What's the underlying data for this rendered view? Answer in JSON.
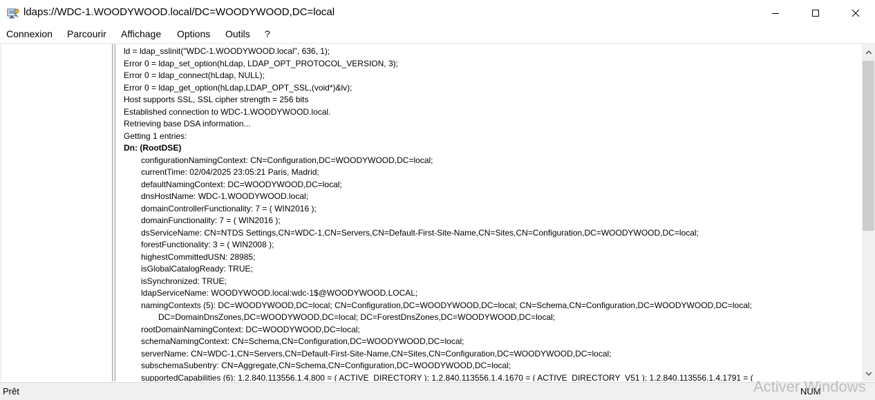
{
  "window": {
    "title": "ldaps://WDC-1.WOODYWOOD.local/DC=WOODYWOOD,DC=local"
  },
  "icons": {
    "app": "ldp-app-icon",
    "minimize": "minimize-icon",
    "maximize": "maximize-icon",
    "close": "close-icon",
    "scroll_up": "chevron-up-icon",
    "scroll_down": "chevron-down-icon"
  },
  "menu": {
    "items": [
      "Connexion",
      "Parcourir",
      "Affichage",
      "Options",
      "Outils",
      "?"
    ]
  },
  "log": {
    "lines": [
      {
        "text": "ld = ldap_sslinit(\"WDC-1.WOODYWOOD.local\", 636, 1);",
        "style": "normal"
      },
      {
        "text": "Error 0 = ldap_set_option(hLdap, LDAP_OPT_PROTOCOL_VERSION, 3);",
        "style": "normal"
      },
      {
        "text": "Error 0 = ldap_connect(hLdap, NULL);",
        "style": "normal"
      },
      {
        "text": "Error 0 = ldap_get_option(hLdap,LDAP_OPT_SSL,(void*)&lv);",
        "style": "normal"
      },
      {
        "text": "Host supports SSL, SSL cipher strength = 256 bits",
        "style": "normal"
      },
      {
        "text": "Established connection to WDC-1.WOODYWOOD.local.",
        "style": "normal"
      },
      {
        "text": "Retrieving base DSA information...",
        "style": "normal"
      },
      {
        "text": "Getting 1 entries:",
        "style": "normal"
      },
      {
        "text": "Dn: (RootDSE)",
        "style": "bold"
      },
      {
        "text": "configurationNamingContext: CN=Configuration,DC=WOODYWOOD,DC=local;",
        "style": "indent1"
      },
      {
        "text": "currentTime: 02/04/2025 23:05:21 Paris, Madrid;",
        "style": "indent1"
      },
      {
        "text": "defaultNamingContext: DC=WOODYWOOD,DC=local;",
        "style": "indent1"
      },
      {
        "text": "dnsHostName: WDC-1.WOODYWOOD.local;",
        "style": "indent1"
      },
      {
        "text": "domainControllerFunctionality: 7 = ( WIN2016 );",
        "style": "indent1"
      },
      {
        "text": "domainFunctionality: 7 = ( WIN2016 );",
        "style": "indent1"
      },
      {
        "text": "dsServiceName: CN=NTDS Settings,CN=WDC-1,CN=Servers,CN=Default-First-Site-Name,CN=Sites,CN=Configuration,DC=WOODYWOOD,DC=local;",
        "style": "indent1"
      },
      {
        "text": "forestFunctionality: 3 = ( WIN2008 );",
        "style": "indent1"
      },
      {
        "text": "highestCommittedUSN: 28985;",
        "style": "indent1"
      },
      {
        "text": "isGlobalCatalogReady: TRUE;",
        "style": "indent1"
      },
      {
        "text": "isSynchronized: TRUE;",
        "style": "indent1"
      },
      {
        "text": "ldapServiceName: WOODYWOOD.local:wdc-1$@WOODYWOOD.LOCAL;",
        "style": "indent1"
      },
      {
        "text": "namingContexts (5): DC=WOODYWOOD,DC=local; CN=Configuration,DC=WOODYWOOD,DC=local; CN=Schema,CN=Configuration,DC=WOODYWOOD,DC=local;",
        "style": "indent1"
      },
      {
        "text": "DC=DomainDnsZones,DC=WOODYWOOD,DC=local; DC=ForestDnsZones,DC=WOODYWOOD,DC=local;",
        "style": "indent2"
      },
      {
        "text": "rootDomainNamingContext: DC=WOODYWOOD,DC=local;",
        "style": "indent1"
      },
      {
        "text": "schemaNamingContext: CN=Schema,CN=Configuration,DC=WOODYWOOD,DC=local;",
        "style": "indent1"
      },
      {
        "text": "serverName: CN=WDC-1,CN=Servers,CN=Default-First-Site-Name,CN=Sites,CN=Configuration,DC=WOODYWOOD,DC=local;",
        "style": "indent1"
      },
      {
        "text": "subschemaSubentry: CN=Aggregate,CN=Schema,CN=Configuration,DC=WOODYWOOD,DC=local;",
        "style": "indent1"
      },
      {
        "text": "supportedCapabilities (6): 1.2.840.113556.1.4.800 = ( ACTIVE_DIRECTORY ); 1.2.840.113556.1.4.1670 = ( ACTIVE_DIRECTORY_V51 ); 1.2.840.113556.1.4.1791 = (",
        "style": "indent1"
      }
    ]
  },
  "status": {
    "text": "Prêt",
    "num": "NUM"
  },
  "watermark": {
    "text": "Activer Windows"
  }
}
